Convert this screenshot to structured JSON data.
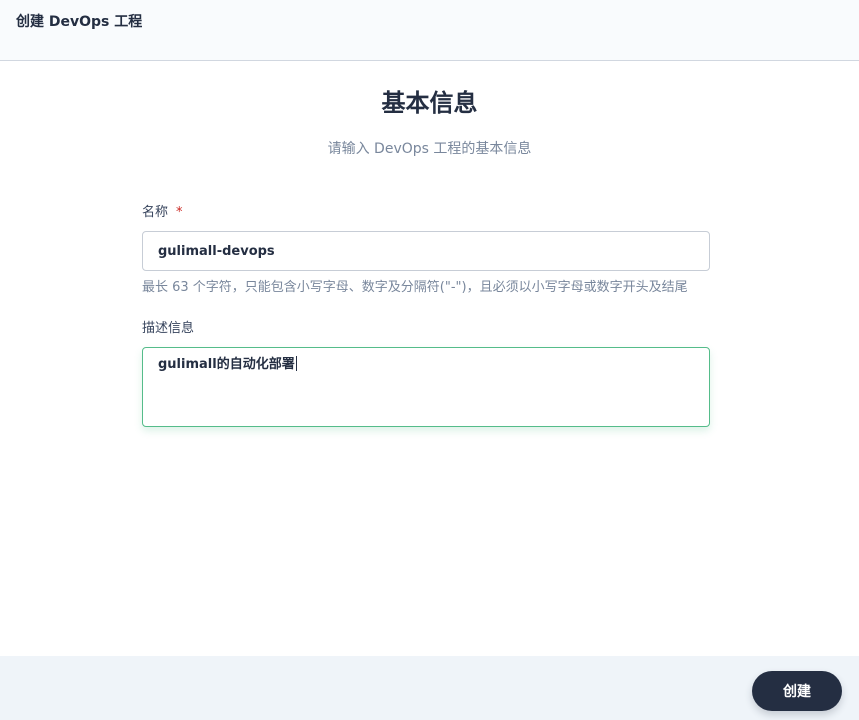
{
  "header": {
    "title": "创建 DevOps 工程"
  },
  "section": {
    "title": "基本信息",
    "subtitle": "请输入 DevOps 工程的基本信息"
  },
  "form": {
    "name": {
      "label": "名称",
      "required_mark": "*",
      "value": "gulimall-devops",
      "hint": "最长 63 个字符，只能包含小写字母、数字及分隔符(\"-\")，且必须以小写字母或数字开头及结尾"
    },
    "description": {
      "label": "描述信息",
      "value": "gulimall的自动化部署"
    }
  },
  "footer": {
    "create_label": "创建"
  },
  "colors": {
    "primary_dark": "#242e42",
    "focus_green": "#55bc8a",
    "required_red": "#ca2621",
    "muted_text": "#79879c"
  }
}
